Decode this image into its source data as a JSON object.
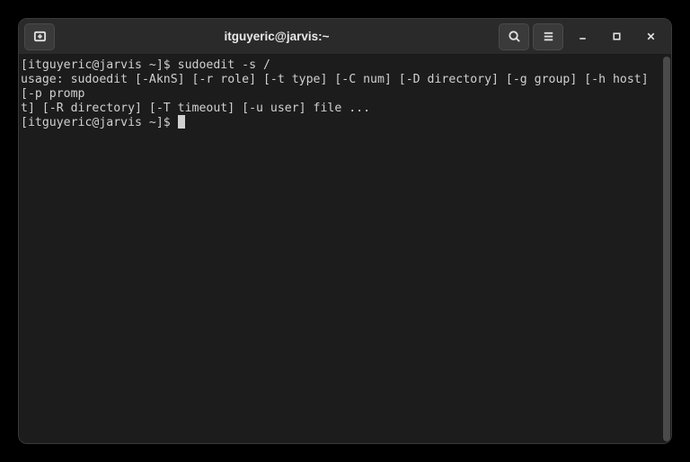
{
  "titlebar": {
    "title": "itguyeric@jarvis:~"
  },
  "terminal": {
    "line1_prompt": "[itguyeric@jarvis ~]$ ",
    "line1_cmd": "sudoedit -s /",
    "line2": "usage: sudoedit [-AknS] [-r role] [-t type] [-C num] [-D directory] [-g group] [-h host] [-p promp",
    "line3": "t] [-R directory] [-T timeout] [-u user] file ...",
    "line4_prompt": "[itguyeric@jarvis ~]$ "
  }
}
